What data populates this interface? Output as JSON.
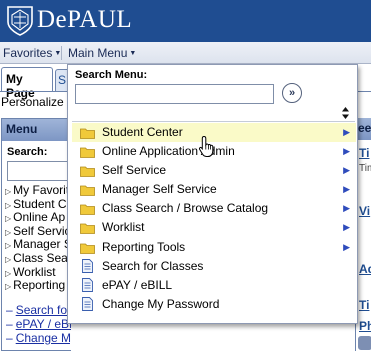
{
  "header": {
    "logo_text": "DePAUL",
    "logo_icon": "seal-icon"
  },
  "menubar": {
    "favorites": "Favorites",
    "main_menu": "Main Menu"
  },
  "tabs": [
    {
      "label": "My Page"
    },
    {
      "label": "S"
    }
  ],
  "personalize_text": "Personalize",
  "left_menu": {
    "title": "Menu",
    "search_label": "Search:",
    "search_value": "",
    "folders": [
      "My Favorit",
      "Student C",
      "Online Ap",
      "Self Servic",
      "Manager S",
      "Class Sea",
      "Worklist",
      "Reporting"
    ],
    "links": [
      "Search fo",
      "ePAY / eBILL",
      "Change My Password"
    ]
  },
  "dropdown": {
    "search_label": "Search Menu:",
    "search_value": "",
    "go_icon": "double-chevron-right-icon",
    "sort_icon": "sort-arrows-icon",
    "items": [
      {
        "label": "Student Center",
        "type": "folder",
        "submenu": true,
        "active": true
      },
      {
        "label": "Online Application Admin",
        "type": "folder",
        "submenu": true,
        "active": false
      },
      {
        "label": "Self Service",
        "type": "folder",
        "submenu": true,
        "active": false
      },
      {
        "label": "Manager Self Service",
        "type": "folder",
        "submenu": true,
        "active": false
      },
      {
        "label": "Class Search / Browse Catalog",
        "type": "folder",
        "submenu": true,
        "active": false
      },
      {
        "label": "Worklist",
        "type": "folder",
        "submenu": true,
        "active": false
      },
      {
        "label": "Reporting Tools",
        "type": "folder",
        "submenu": true,
        "active": false
      },
      {
        "label": "Search for Classes",
        "type": "page",
        "submenu": false,
        "active": false
      },
      {
        "label": "ePAY / eBILL",
        "type": "page",
        "submenu": false,
        "active": false
      },
      {
        "label": "Change My Password",
        "type": "page",
        "submenu": false,
        "active": false
      }
    ]
  },
  "right_pagelet": {
    "header": "ee",
    "fragments": [
      "Ti",
      "Tim",
      "Vi",
      "Ad",
      "Ti",
      "Ph"
    ]
  },
  "colors": {
    "header_bg": "#1f4d91",
    "highlight": "#fafac8",
    "link": "#1a2fa3",
    "folder": "#f0c93a"
  }
}
